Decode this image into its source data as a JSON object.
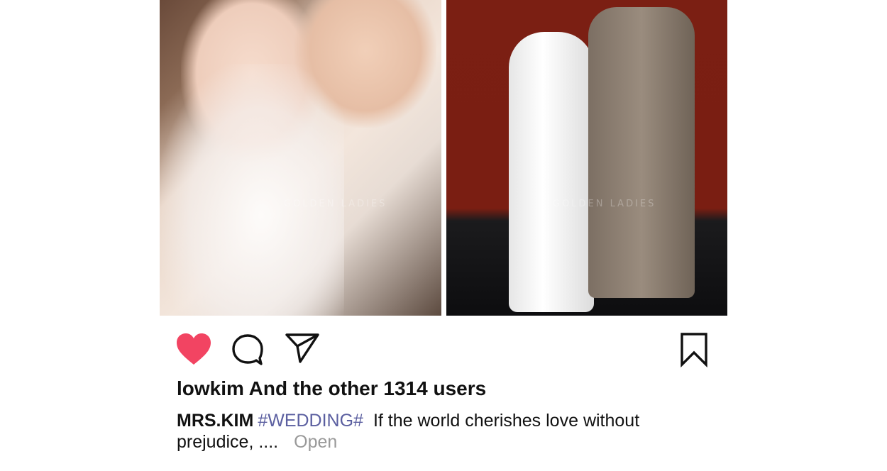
{
  "photos": {
    "left": {
      "watermark": "GOLDEN LADIES"
    },
    "right": {
      "watermark": "GOLDEN LADIES"
    }
  },
  "actions": {
    "like_icon": "heart-icon",
    "comment_icon": "comment-icon",
    "share_icon": "send-icon",
    "save_icon": "bookmark-icon",
    "like_color": "#f24462"
  },
  "likes": {
    "text": "lowkim And the other 1314 users"
  },
  "caption": {
    "username": "MRS.KIM",
    "hashtag": "#WEDDING#",
    "text": "If the world cherishes love without prejudice, ....",
    "more": "Open"
  }
}
